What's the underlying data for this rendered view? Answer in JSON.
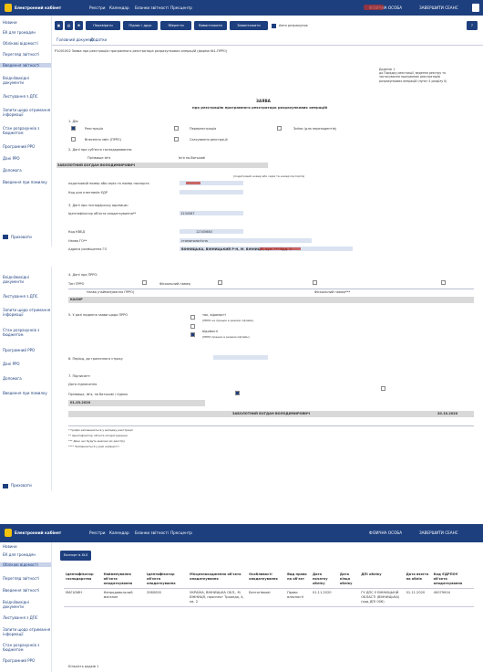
{
  "header": {
    "app": "Електронний кабінет",
    "menu": [
      "Реєстри",
      "Календар",
      "Бланки звітності",
      "Пресцентр"
    ],
    "user_type": "ФІЗИЧНА ОСОБА",
    "logout": "ЗАВЕРШИТИ СЕАНС"
  },
  "sidebar": {
    "items_a": [
      "Новини",
      "ЕК для громадян",
      "Облікові відомості",
      "Перегляд звітності",
      "Введення звітності",
      "Вхідні/вихідні документи",
      "Листування з ДПС",
      "Запити щодо отримання інформації",
      "Стан розрахунків з бюджетом",
      "Програмний РРО",
      "Дані РРО",
      "Допомога",
      "Введення при помилку"
    ],
    "items_b": [
      "Вхідні/вихідні документи",
      "Листування з ДПС",
      "Запити щодо отримання інформації",
      "Стан розрахунків з бюджетом",
      "Програмний РРО",
      "Дані РРО",
      "Допомога",
      "Введення при помилку"
    ],
    "items_c": [
      "Новини",
      "ЕК для громадян",
      "Облікові відомості",
      "Перегляд звітності",
      "Введення звітності",
      "Вхідні/вихідні документи",
      "Листування з ДПС",
      "Запити щодо отримання інформації",
      "Стан розрахунків з бюджетом",
      "Програмний РРО"
    ],
    "collapse": "Приховати"
  },
  "toolbar": {
    "buttons": [
      "Перевірити",
      "Підпис і друк",
      "Зберегти",
      "Вивантажити",
      "Завантажити"
    ],
    "autosave": "Авто розрахунок",
    "help": "?"
  },
  "tabs": [
    "Головний документ",
    "Додатки"
  ],
  "doc": {
    "form_name": "Р1001002 Заява про реєстрацію програмного реєстратора розрахункових операцій (форма №1-ПРРО)",
    "annex": "Додаток 1\nдо Порядку реєстрації, ведення реєстру та застосування програмних реєстраторів розрахункових операцій (пункт 4 розділу II)",
    "title": "ЗАЯВА",
    "subtitle": "про реєстрацію програмного реєстратора розрахункових операцій",
    "s1": "1. Дія:",
    "s1_opts": [
      "Реєстрація",
      "Перереєстрація",
      "Зміни (для нерезидентів)",
      "Внесення змін (ПРРО)",
      "Скасування реєстрації"
    ],
    "s2": "2. Дані про суб'єкта господарювання:",
    "s2_cols": [
      "Прізвище ім'я",
      "Ім'я по-батькові",
      "Повне найменування"
    ],
    "fop": "ЗАБОЛОТНИЙ БОГДАН ВОЛОДИМИРОВИЧ",
    "s2_note": "(податковий номер або серія та номер паспорта)",
    "s2_ident": "податковий номер або серія та номер паспорта",
    "s2_code": "Код для платників ЄДР",
    "s3": "3. Дані про господарську одиницю:",
    "s3_a": "Ідентифікатор об'єкта оподаткування**",
    "s3_a_val": "1234567",
    "s3_b": "Код КВЕД",
    "s3_b_val": "12345680",
    "s3_c": "Назва ГО**",
    "s3_c_val": "стоматологічна",
    "s3_d": "Адреса розміщення ГО",
    "s3_d_val": "ВІННИЦЬКА, ВІННИЦЬКИЙ Р-Н, М. ВІННИЦЯ, вул. *** буд. 2",
    "s4": "4. Дані про ПРРО:",
    "s4_cols": [
      "Тип ПРРО",
      "Фіскальний номер",
      "Локальний номер",
      "Назва (найменування ПРРО)",
      "Фіскальний номер***"
    ],
    "s4_row": "КАСИР",
    "s5": "5. У разі надання заяви щодо ПРРО",
    "s5_opts": [
      "так, відомості",
      "(ПРРО не працює в режимі офлайн)",
      "відомості",
      "(ПРРО працює в режимі офлайн)"
    ],
    "s6": "6. Період, до граничного строку",
    "s7": "7. Підписант:",
    "s7_a": "Дата підписання",
    "s7_b": "Прізвище, ім'я, по батькові / підпис",
    "s7_date": "01.03.2020",
    "s7_name": "ЗАБОЛОТНИЙ БОГДАН ВОЛОДИМИРОВИЧ",
    "s7_date2": "20.10.2020",
    "footnotes": [
      "* Графи заповнюються у випадку реєстрації",
      "** Ідентифікатор об'єкта оподаткування",
      "*** Дані, що будуть внесені до реєстру",
      "**** Заповнюється у разі наявності"
    ]
  },
  "table3": {
    "export": "Експорт в XLS",
    "cols": [
      "Ідентифікатор господарства",
      "Найменування об'єкта оподаткування",
      "Ідентифікатор об'єкта оподаткування",
      "Місцезнаходження об'єкта оподаткування",
      "Особливості оподаткування",
      "Вид права на об'єкт",
      "Дата початку обліку",
      "Дата кінця обліку",
      "ДПІ обліку",
      "Дата взяття на облік",
      "Код ЄДРПОУ об'єкта оподаткування"
    ],
    "row": [
      "МАГАЗИН",
      "Непродовольчий магазин",
      "2080000",
      "УКРАЇНА, ВІННИЦЬКА ОБЛ., М. ВІННИЦЯ, проспект Троянда, 4, кв. 2",
      "Безготівкові",
      "Право власності",
      "01.11.2020",
      "",
      "ГУ ДПС У ВІННИЦЬКІЙ ОБЛАСТІ (ВІННИЦЬКА) (код ДПІ 006)",
      "01.11.2020",
      "40079004"
    ],
    "footer": "Кількість рядків 1"
  }
}
